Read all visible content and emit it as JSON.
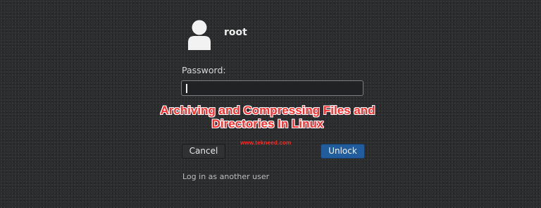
{
  "user": {
    "name": "root",
    "avatar_icon": "user-avatar-icon"
  },
  "password": {
    "label": "Password:",
    "value": ""
  },
  "overlay": {
    "title_line1": "Archiving and Compressing Files and",
    "title_line2": "Directories In Linux",
    "watermark": "www.tekneed.com"
  },
  "buttons": {
    "cancel_label": "Cancel",
    "unlock_label": "Unlock"
  },
  "links": {
    "other_user": "Log in as another user"
  },
  "colors": {
    "background": "#2b2d2e",
    "accent": "#215d9c",
    "overlay_text": "#ff2b2b"
  }
}
